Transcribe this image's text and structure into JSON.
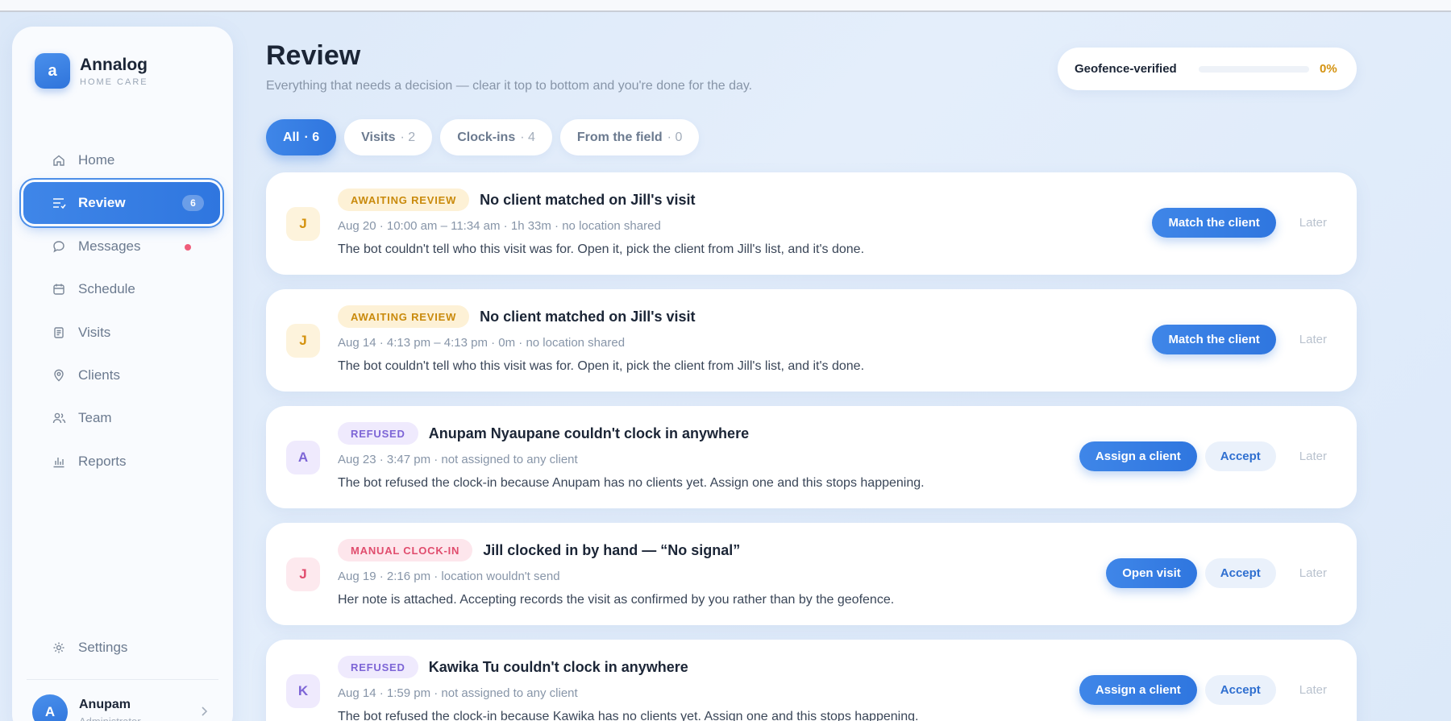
{
  "app": {
    "logo_letter": "a",
    "name": "Annalog",
    "subtitle": "HOME CARE"
  },
  "sidebar": {
    "items": [
      {
        "label": "Home",
        "icon": "home-icon"
      },
      {
        "label": "Review",
        "icon": "review-list-icon",
        "badge": "6",
        "active": true
      },
      {
        "label": "Messages",
        "icon": "message-bubble-icon",
        "dot": true
      },
      {
        "label": "Schedule",
        "icon": "calendar-icon"
      },
      {
        "label": "Visits",
        "icon": "document-icon"
      },
      {
        "label": "Clients",
        "icon": "location-pin-icon"
      },
      {
        "label": "Team",
        "icon": "users-icon"
      },
      {
        "label": "Reports",
        "icon": "bar-chart-icon"
      }
    ],
    "settings_label": "Settings",
    "user": {
      "initial": "A",
      "name": "Anupam",
      "role": "Administrator"
    }
  },
  "header": {
    "title": "Review",
    "subtitle": "Everything that needs a decision — clear it top to bottom and you're done for the day.",
    "geofence_label": "Geofence-verified",
    "geofence_pct": "0%",
    "geofence_value": 0
  },
  "tabs": [
    {
      "label": "All",
      "count": "· 6"
    },
    {
      "label": "Visits",
      "count": "· 2"
    },
    {
      "label": "Clock-ins",
      "count": "· 4"
    },
    {
      "label": "From the field",
      "count": "· 0"
    }
  ],
  "cards": [
    {
      "initial": "J",
      "badge": "AWAITING REVIEW",
      "title": "No client matched on Jill's visit",
      "meta": "Aug 20 · 10:00 am – 11:34 am · 1h 33m · no location shared",
      "desc": "The bot couldn't tell who this visit was for. Open it, pick the client from Jill's list, and it's done.",
      "primary": "Match the client",
      "later": "Later"
    },
    {
      "initial": "J",
      "badge": "AWAITING REVIEW",
      "title": "No client matched on Jill's visit",
      "meta": "Aug 14 · 4:13 pm – 4:13 pm · 0m · no location shared",
      "desc": "The bot couldn't tell who this visit was for. Open it, pick the client from Jill's list, and it's done.",
      "primary": "Match the client",
      "later": "Later"
    },
    {
      "initial": "A",
      "badge": "REFUSED",
      "title": "Anupam Nyaupane couldn't clock in anywhere",
      "meta": "Aug 23 · 3:47 pm · not assigned to any client",
      "desc": "The bot refused the clock-in because Anupam has no clients yet. Assign one and this stops happening.",
      "primary": "Assign a client",
      "accept": "Accept",
      "later": "Later"
    },
    {
      "initial": "J",
      "badge": "MANUAL CLOCK-IN",
      "title": "Jill clocked in by hand — “No signal”",
      "meta": "Aug 19 · 2:16 pm · location wouldn't send",
      "desc": "Her note is attached. Accepting records the visit as confirmed by you rather than by the geofence.",
      "primary": "Open visit",
      "accept": "Accept",
      "later": "Later"
    },
    {
      "initial": "K",
      "badge": "REFUSED",
      "title": "Kawika Tu couldn't clock in anywhere",
      "meta": "Aug 14 · 1:59 pm · not assigned to any client",
      "desc": "The bot refused the clock-in because Kawika has no clients yet. Assign one and this stops happening.",
      "primary": "Assign a client",
      "accept": "Accept",
      "later": "Later"
    }
  ]
}
